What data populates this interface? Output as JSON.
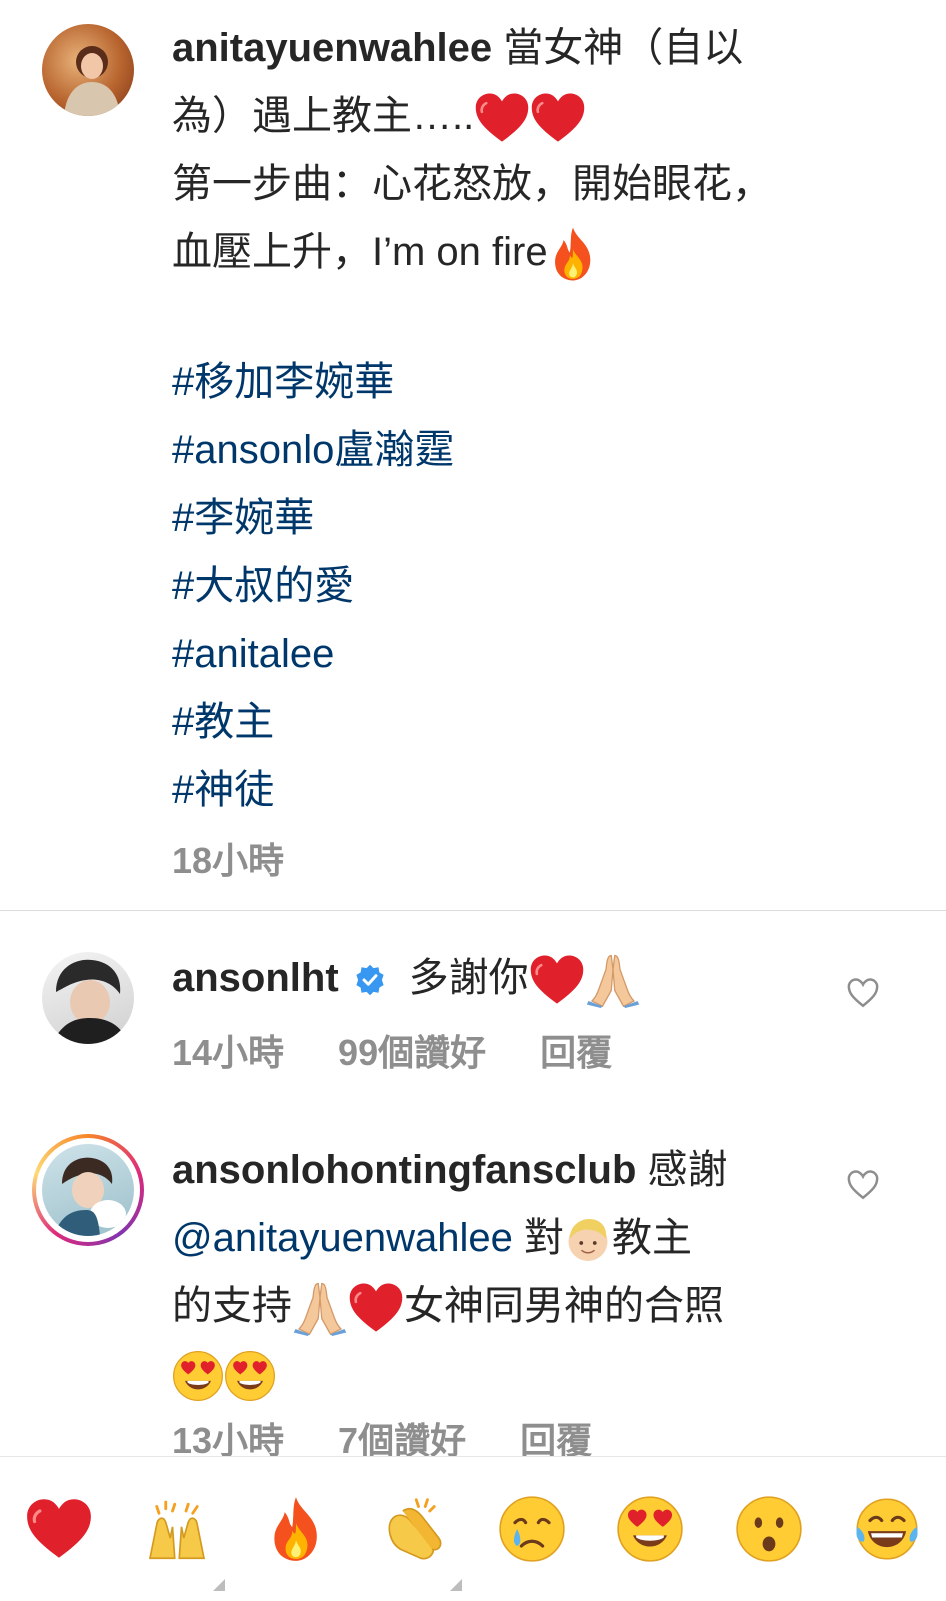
{
  "post": {
    "username": "anitayuenwahlee",
    "caption_line1": "當女神（自以",
    "caption_line2": "為）遇上教主…..",
    "caption_line3": "第一步曲：心花怒放，開始眼花，",
    "caption_line4": "血壓上升，I’m on fire",
    "hashtags": [
      "#移加李婉華",
      "#ansonlo盧瀚霆",
      "#李婉華",
      "#大叔的愛",
      "#anitalee",
      "#教主",
      "#神徒"
    ],
    "time": "18小時"
  },
  "comments": [
    {
      "username": "ansonlht",
      "verified": true,
      "text": "多謝你",
      "time": "14小時",
      "likes": "99個讚好",
      "reply_label": "回覆"
    },
    {
      "username": "ansonlohontingfansclub",
      "text_line1": "感謝",
      "mention": "@anitayuenwahlee",
      "text_line2a": "對",
      "text_line2b": "教主",
      "text_line3a": "的支持",
      "text_line3b": "女神同男神的合照",
      "time": "13小時",
      "likes": "7個讚好",
      "reply_label": "回覆"
    }
  ],
  "reaction_bar": {
    "icons": [
      "heart-icon",
      "raising-hands-icon",
      "fire-icon",
      "clapping-hands-icon",
      "crying-face-icon",
      "heart-eyes-icon",
      "surprised-face-icon",
      "tears-of-joy-icon"
    ]
  },
  "colors": {
    "hashtag": "#00376b",
    "meta_gray": "#8e8e8e",
    "verified_blue": "#3897f0",
    "heart_red": "#e0202a"
  }
}
